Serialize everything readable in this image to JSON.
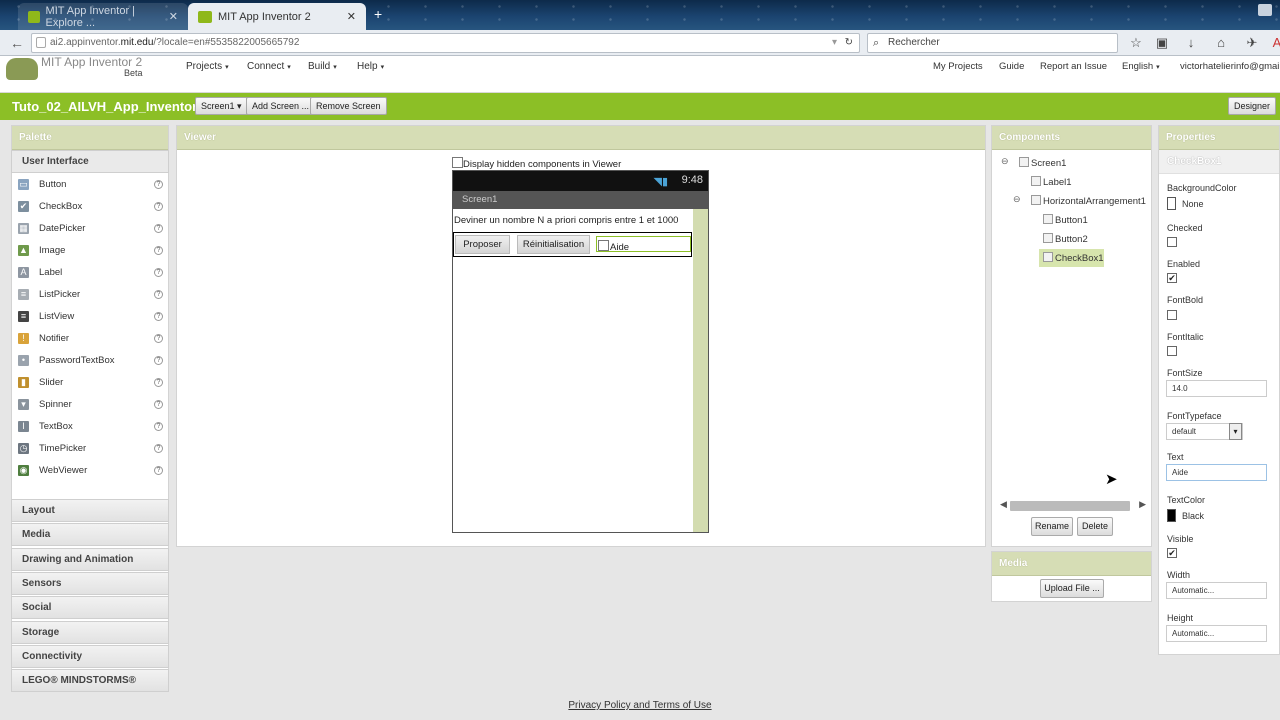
{
  "browser": {
    "tabs": [
      {
        "title": "MIT App Inventor | Explore ...",
        "close": "✕"
      },
      {
        "title": "MIT App Inventor 2",
        "close": "✕"
      }
    ],
    "new_tab": "+",
    "url_prefix": "ai2.appinventor.",
    "url_host": "mit.edu",
    "url_rest": "/?locale=en#5535822005665792",
    "search_placeholder": "Rechercher"
  },
  "app": {
    "brand": "MIT App Inventor 2",
    "beta": "Beta",
    "menus": [
      "Projects",
      "Connect",
      "Build",
      "Help"
    ],
    "right_links": [
      "My Projects",
      "Guide",
      "Report an Issue",
      "English",
      "victorhatelierinfo@gmail"
    ]
  },
  "project": {
    "name": "Tuto_02_AILVH_App_Inventor",
    "screen_select": "Screen1 ▾",
    "add_screen": "Add Screen ...",
    "remove_screen": "Remove Screen",
    "designer": "Designer"
  },
  "palette": {
    "title": "Palette",
    "open_category": "User Interface",
    "items": [
      {
        "label": "Button",
        "icon": "button-icon",
        "glyph": "▭",
        "color": "#8aa4c0"
      },
      {
        "label": "CheckBox",
        "icon": "checkbox-icon",
        "glyph": "✔",
        "color": "#7d8f9e"
      },
      {
        "label": "DatePicker",
        "icon": "datepicker-icon",
        "glyph": "▦",
        "color": "#9aa3ad"
      },
      {
        "label": "Image",
        "icon": "image-icon",
        "glyph": "▲",
        "color": "#6f9a4b"
      },
      {
        "label": "Label",
        "icon": "label-icon",
        "glyph": "A",
        "color": "#8e96a1"
      },
      {
        "label": "ListPicker",
        "icon": "listpicker-icon",
        "glyph": "≡",
        "color": "#a7adb3"
      },
      {
        "label": "ListView",
        "icon": "listview-icon",
        "glyph": "≡",
        "color": "#444444"
      },
      {
        "label": "Notifier",
        "icon": "notifier-icon",
        "glyph": "!",
        "color": "#d9a33a"
      },
      {
        "label": "PasswordTextBox",
        "icon": "password-icon",
        "glyph": "•",
        "color": "#9aa3ad"
      },
      {
        "label": "Slider",
        "icon": "slider-icon",
        "glyph": "▮",
        "color": "#c0902e"
      },
      {
        "label": "Spinner",
        "icon": "spinner-icon",
        "glyph": "▾",
        "color": "#8a939c"
      },
      {
        "label": "TextBox",
        "icon": "textbox-icon",
        "glyph": "I",
        "color": "#7b8691"
      },
      {
        "label": "TimePicker",
        "icon": "timepicker-icon",
        "glyph": "◷",
        "color": "#6d7680"
      },
      {
        "label": "WebViewer",
        "icon": "webviewer-icon",
        "glyph": "◉",
        "color": "#4f7e3f"
      }
    ],
    "help": "?",
    "categories": [
      "Layout",
      "Media",
      "Drawing and Animation",
      "Sensors",
      "Social",
      "Storage",
      "Connectivity",
      "LEGO® MINDSTORMS®"
    ]
  },
  "viewer": {
    "title": "Viewer",
    "hidden_label": "Display hidden components in Viewer",
    "time": "9:48",
    "screen_title": "Screen1",
    "label1": "Deviner un nombre N a priori compris entre 1 et 1000",
    "button1": "Proposer",
    "button2": "Réinitialisation",
    "checkbox": "Aide"
  },
  "components": {
    "title": "Components",
    "tree": [
      "Screen1",
      "Label1",
      "HorizontalArrangement1",
      "Button1",
      "Button2",
      "CheckBox1"
    ],
    "collapse": "⊖",
    "rename": "Rename",
    "delete": "Delete"
  },
  "media": {
    "title": "Media",
    "upload": "Upload File ..."
  },
  "properties": {
    "title": "Properties",
    "component": "CheckBox1",
    "background_color_label": "BackgroundColor",
    "background_color_value": "None",
    "checked_label": "Checked",
    "enabled_label": "Enabled",
    "fontbold_label": "FontBold",
    "fontitalic_label": "FontItalic",
    "fontsize_label": "FontSize",
    "fontsize_value": "14.0",
    "fonttypeface_label": "FontTypeface",
    "fonttypeface_value": "default",
    "text_label": "Text",
    "text_value": "Aide",
    "textcolor_label": "TextColor",
    "textcolor_value": "Black",
    "visible_label": "Visible",
    "width_label": "Width",
    "width_value": "Automatic...",
    "height_label": "Height",
    "height_value": "Automatic..."
  },
  "footer": "Privacy Policy and Terms of Use",
  "colors": {
    "accent_green": "#8cbf26",
    "panel_header": "#d6ddb5"
  }
}
